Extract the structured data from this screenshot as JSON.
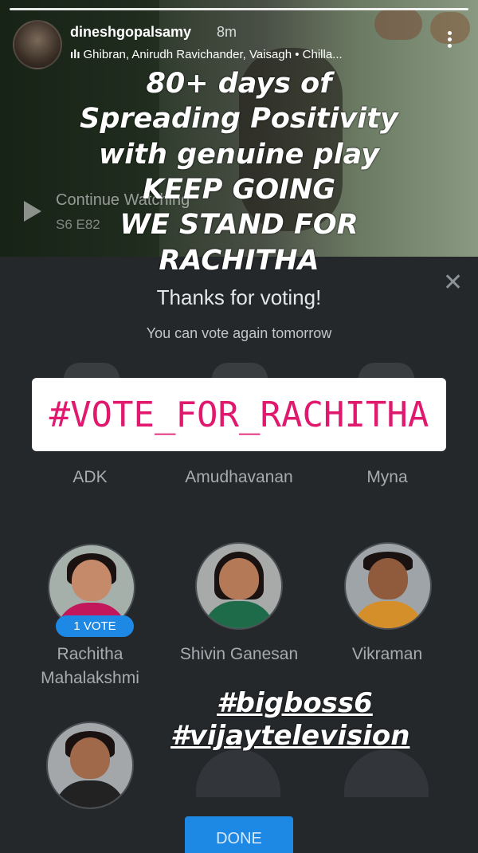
{
  "story": {
    "username": "dineshgopalsamy",
    "time": "8m",
    "music": "Ghibran, Anirudh Ravichander, Vaisagh • Chilla...",
    "music_icon": "sound-bars-icon"
  },
  "video": {
    "continue_label": "Continue Watching",
    "episode_label": "S6 E82"
  },
  "overlay_lines": [
    "80+ days of",
    "Spreading Positivity",
    "with genuine play",
    "KEEP GOING",
    "WE STAND FOR",
    "RACHITHA"
  ],
  "vote_panel": {
    "title": "Thanks for voting!",
    "subtitle": "You can vote again tomorrow",
    "close_icon": "close-icon",
    "candidates_row1": [
      "ADK",
      "Amudhavanan",
      "Myna"
    ],
    "candidates_row2": [
      {
        "name_line1": "Rachitha",
        "name_line2": "Mahalakshmi",
        "badge": "1 VOTE"
      },
      {
        "name_line1": "Shivin Ganesan",
        "name_line2": ""
      },
      {
        "name_line1": "Vikraman",
        "name_line2": ""
      }
    ],
    "done_label": "DONE"
  },
  "sticker": {
    "vote_hashtag": "#VOTE_FOR_RACHITHA"
  },
  "hashtags": [
    "#bigboss6",
    "#vijaytelevision"
  ],
  "colors": {
    "accent_pink": "#e0196f",
    "button_blue": "#1e88e5",
    "panel_bg": "#25282b"
  }
}
